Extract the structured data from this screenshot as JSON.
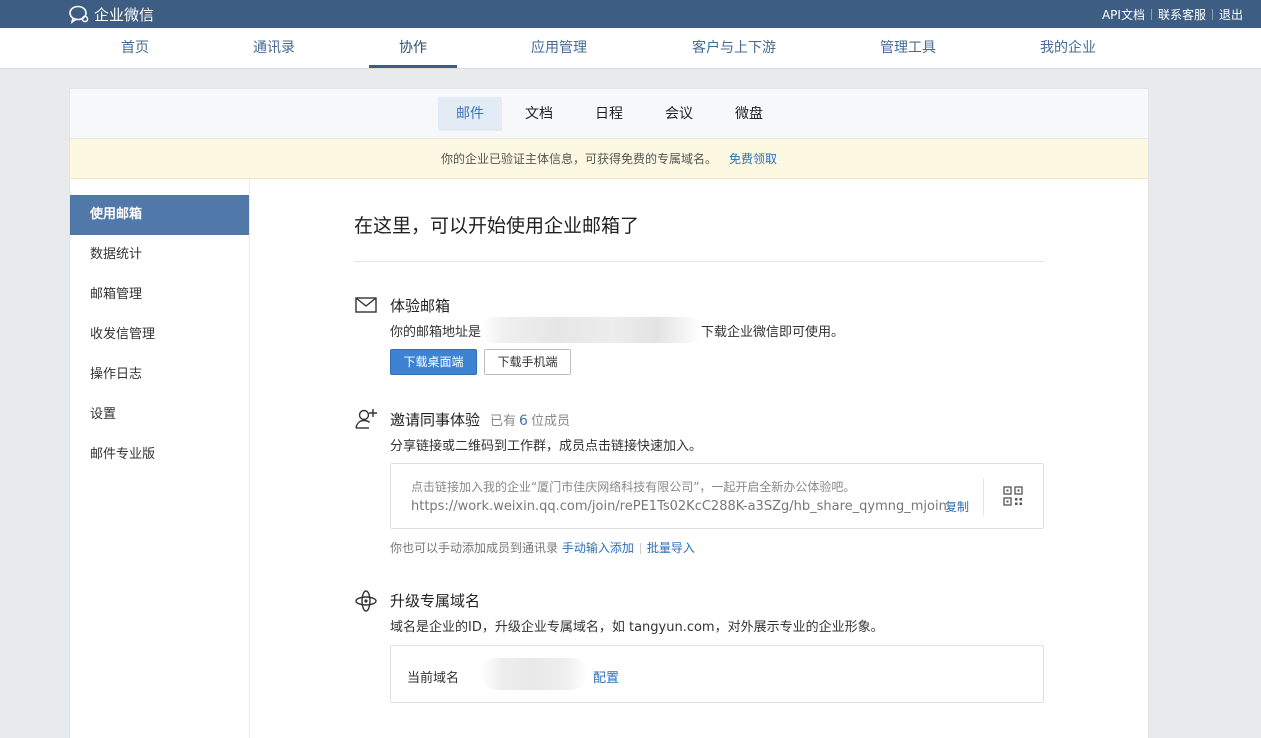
{
  "app": {
    "title": "企业微信"
  },
  "toplinks": [
    "API文档",
    "联系客服",
    "退出"
  ],
  "mainnav": {
    "items": [
      "首页",
      "通讯录",
      "协作",
      "应用管理",
      "客户与上下游",
      "管理工具",
      "我的企业"
    ],
    "active": "协作"
  },
  "subtabs": {
    "items": [
      "邮件",
      "文档",
      "日程",
      "会议",
      "微盘"
    ],
    "active": "邮件"
  },
  "notice": {
    "text": "你的企业已验证主体信息，可获得免费的专属域名。",
    "link": "免费领取"
  },
  "sidebar": {
    "items": [
      "使用邮箱",
      "数据统计",
      "邮箱管理",
      "收发信管理",
      "操作日志",
      "设置",
      "邮件专业版"
    ],
    "active": "使用邮箱"
  },
  "main": {
    "title": "在这里，可以开始使用企业邮箱了",
    "trial": {
      "title": "体验邮箱",
      "desc_prefix": "你的邮箱地址是",
      "desc_suffix": "下载企业微信即可使用。",
      "btn_desktop": "下载桌面端",
      "btn_mobile": "下载手机端"
    },
    "invite": {
      "title": "邀请同事体验",
      "count_prefix": "已有",
      "count": "6",
      "count_suffix": "位成员",
      "desc": "分享链接或二维码到工作群，成员点击链接快速加入。",
      "invite_text": "点击链接加入我的企业“厦门市佳庆网络科技有限公司”，一起开启全新办公体验吧。",
      "invite_url": "https://work.weixin.qq.com/join/rePE1Ts02KcC288K-a3SZg/hb_share_qymng_mjoin",
      "copy": "复制",
      "manual_text": "你也可以手动添加成员到通讯录",
      "manual_link": "手动输入添加",
      "batch_link": "批量导入"
    },
    "domain": {
      "title": "升级专属域名",
      "desc": "域名是企业的ID，升级企业专属域名，如 tangyun.com，对外展示专业的企业形象。",
      "label": "当前域名",
      "config": "配置"
    }
  },
  "colors": {
    "topbar": "#3d5d82",
    "accent": "#3d83d1",
    "link": "#2c6fb8",
    "sidebar_active": "#5079a9",
    "notice_bg": "#fdf8e2"
  },
  "icons": [
    "chat-logo-icon",
    "mail-icon",
    "add-user-icon",
    "orbit-icon",
    "qrcode-icon"
  ]
}
